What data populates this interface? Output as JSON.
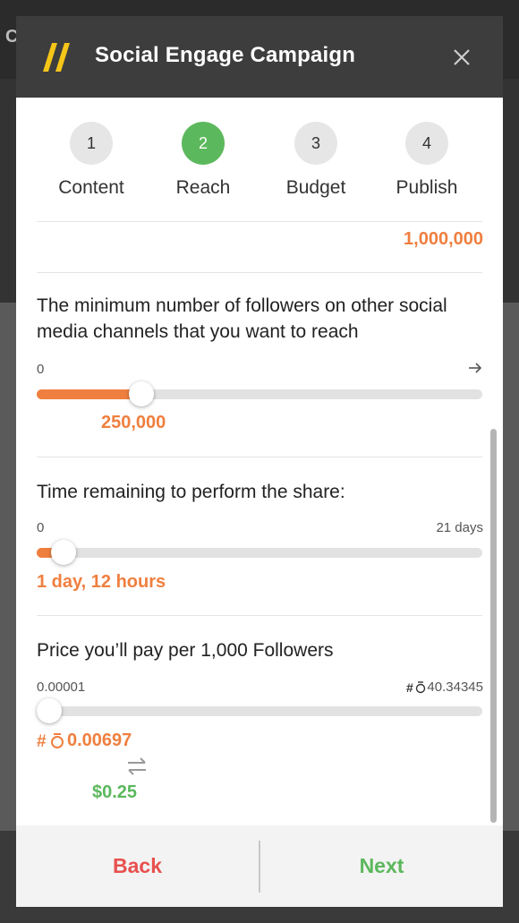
{
  "background": {
    "logo_text": "C"
  },
  "modal": {
    "title": "Social Engage Campaign",
    "logo_icon": "double-slash-logo",
    "close_icon": "close-icon"
  },
  "steps": [
    {
      "number": "1",
      "label": "Content",
      "active": false
    },
    {
      "number": "2",
      "label": "Reach",
      "active": true
    },
    {
      "number": "3",
      "label": "Budget",
      "active": false
    },
    {
      "number": "4",
      "label": "Publish",
      "active": false
    }
  ],
  "previous_value": "1,000,000",
  "followers_slider": {
    "question": "The minimum number of followers on other social media channels that you want to reach",
    "min_label": "0",
    "max_icon": "arrow-right-icon",
    "value_label": "250,000",
    "fill_fraction": 0.235
  },
  "time_slider": {
    "question": "Time remaining to perform the share:",
    "min_label": "0",
    "max_label": "21 days",
    "value_label": "1 day, 12 hours",
    "fill_fraction": 0.06
  },
  "price_slider": {
    "question": "Price you’ll pay per 1,000 Followers",
    "min_label": "0.00001",
    "max_label": "40.34345",
    "currency_icon": "token-currency-icon",
    "value_label": "0.00697",
    "swap_icon": "swap-arrows-icon",
    "usd_value": "$0.25",
    "fill_fraction": 0.02
  },
  "footer": {
    "back_label": "Back",
    "next_label": "Next"
  },
  "colors": {
    "accent_orange": "#ef7f3f",
    "success_green": "#5cb85c",
    "back_red": "#e8504f",
    "header_dark": "#3d3d3d",
    "logo_yellow": "#f5c518"
  }
}
